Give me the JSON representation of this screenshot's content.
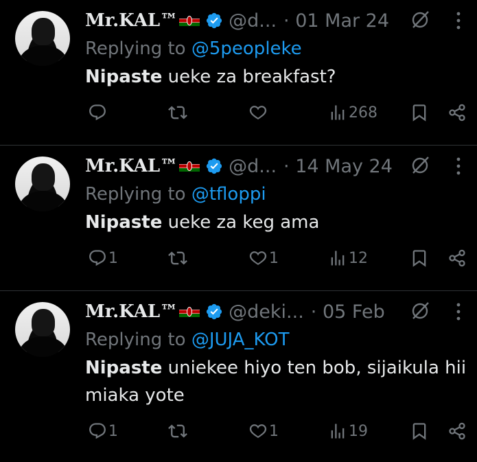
{
  "tweets": [
    {
      "name": "Mr.KAL™",
      "handle": "@d...",
      "date": "· 01 Mar 24",
      "reply_prefix": "Replying to ",
      "reply_to": "@5peopleke",
      "bold": "Nipaste",
      "text": " ueke za breakfast?",
      "replies": "",
      "likes": "",
      "views": "268"
    },
    {
      "name": "Mr.KAL™",
      "handle": "@d...",
      "date": "· 14 May 24",
      "reply_prefix": "Replying to ",
      "reply_to": "@tfloppi",
      "bold": "Nipaste",
      "text": " ueke za keg ama",
      "replies": "1",
      "likes": "1",
      "views": "12"
    },
    {
      "name": "Mr.KAL™",
      "handle": "@deki...",
      "date": "· 05 Feb",
      "reply_prefix": "Replying to ",
      "reply_to": "@JUJA_KOT",
      "bold": "Nipaste",
      "text": " uniekee hiyo ten bob, sijaikula hii miaka yote",
      "replies": "1",
      "likes": "1",
      "views": "19"
    }
  ],
  "colors": {
    "accent": "#1d9bf0",
    "muted": "#71767b",
    "text": "#e7e9ea",
    "background": "#000000",
    "divider": "#2f3336"
  }
}
